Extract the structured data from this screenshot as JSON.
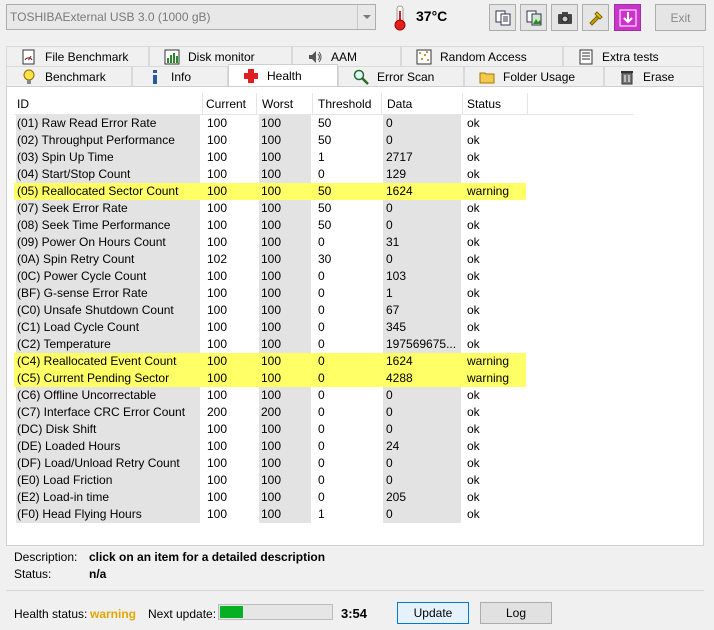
{
  "toolbar": {
    "drive": "TOSHIBAExternal USB 3.0 (1000 gB)",
    "temperature": "37°C",
    "exit_label": "Exit"
  },
  "tabs_top": [
    {
      "label": "File Benchmark",
      "icon": "file-benchmark-icon"
    },
    {
      "label": "Disk monitor",
      "icon": "disk-monitor-icon"
    },
    {
      "label": "AAM",
      "icon": "speaker-icon"
    },
    {
      "label": "Random Access",
      "icon": "random-access-icon"
    },
    {
      "label": "Extra tests",
      "icon": "extra-tests-icon"
    }
  ],
  "tabs_bottom": [
    {
      "label": "Benchmark",
      "icon": "benchmark-icon"
    },
    {
      "label": "Info",
      "icon": "info-icon"
    },
    {
      "label": "Health",
      "icon": "health-cross-icon"
    },
    {
      "label": "Error Scan",
      "icon": "magnifier-icon"
    },
    {
      "label": "Folder Usage",
      "icon": "folder-icon"
    },
    {
      "label": "Erase",
      "icon": "trash-icon"
    }
  ],
  "table": {
    "headers": [
      "ID",
      "Current",
      "Worst",
      "Threshold",
      "Data",
      "Status"
    ],
    "rows": [
      [
        "(01) Raw Read Error Rate",
        "100",
        "100",
        "50",
        "0",
        "ok"
      ],
      [
        "(02) Throughput Performance",
        "100",
        "100",
        "50",
        "0",
        "ok"
      ],
      [
        "(03) Spin Up Time",
        "100",
        "100",
        "1",
        "2717",
        "ok"
      ],
      [
        "(04) Start/Stop Count",
        "100",
        "100",
        "0",
        "129",
        "ok"
      ],
      [
        "(05) Reallocated Sector Count",
        "100",
        "100",
        "50",
        "1624",
        "warning"
      ],
      [
        "(07) Seek Error Rate",
        "100",
        "100",
        "50",
        "0",
        "ok"
      ],
      [
        "(08) Seek Time Performance",
        "100",
        "100",
        "50",
        "0",
        "ok"
      ],
      [
        "(09) Power On Hours Count",
        "100",
        "100",
        "0",
        "31",
        "ok"
      ],
      [
        "(0A) Spin Retry Count",
        "102",
        "100",
        "30",
        "0",
        "ok"
      ],
      [
        "(0C) Power Cycle Count",
        "100",
        "100",
        "0",
        "103",
        "ok"
      ],
      [
        "(BF) G-sense Error Rate",
        "100",
        "100",
        "0",
        "1",
        "ok"
      ],
      [
        "(C0) Unsafe Shutdown Count",
        "100",
        "100",
        "0",
        "67",
        "ok"
      ],
      [
        "(C1) Load Cycle Count",
        "100",
        "100",
        "0",
        "345",
        "ok"
      ],
      [
        "(C2) Temperature",
        "100",
        "100",
        "0",
        "197569675...",
        "ok"
      ],
      [
        "(C4) Reallocated Event Count",
        "100",
        "100",
        "0",
        "1624",
        "warning"
      ],
      [
        "(C5) Current Pending Sector",
        "100",
        "100",
        "0",
        "4288",
        "warning"
      ],
      [
        "(C6) Offline Uncorrectable",
        "100",
        "100",
        "0",
        "0",
        "ok"
      ],
      [
        "(C7) Interface CRC Error Count",
        "200",
        "200",
        "0",
        "0",
        "ok"
      ],
      [
        "(DC) Disk Shift",
        "100",
        "100",
        "0",
        "0",
        "ok"
      ],
      [
        "(DE) Loaded Hours",
        "100",
        "100",
        "0",
        "24",
        "ok"
      ],
      [
        "(DF) Load/Unload Retry Count",
        "100",
        "100",
        "0",
        "0",
        "ok"
      ],
      [
        "(E0) Load Friction",
        "100",
        "100",
        "0",
        "0",
        "ok"
      ],
      [
        "(E2) Load-in time",
        "100",
        "100",
        "0",
        "205",
        "ok"
      ],
      [
        "(F0) Head Flying Hours",
        "100",
        "100",
        "1",
        "0",
        "ok"
      ]
    ]
  },
  "description": {
    "label": "Description:",
    "value": "click on an item for a detailed description",
    "status_label": "Status:",
    "status_value": "n/a"
  },
  "footer": {
    "health_label": "Health status:",
    "health_value": "warning",
    "next_update_label": "Next update:",
    "progress_fraction": 0.2,
    "time": "3:54",
    "update_label": "Update",
    "log_label": "Log"
  },
  "colors": {
    "warning_row": "#ffff66",
    "health_warning_text": "#e6a800",
    "progress_fill": "#06b025",
    "health_tab_cross": "#e02020",
    "toolbar_purple": "#cc33cc"
  }
}
